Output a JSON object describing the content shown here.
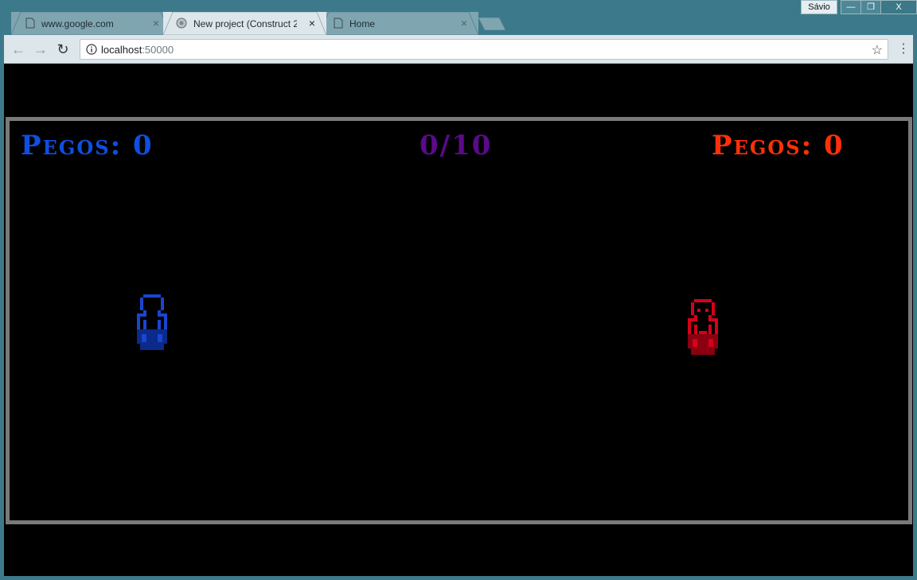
{
  "window": {
    "profile_label": "Sávio",
    "minimize_glyph": "—",
    "maximize_glyph": "❐",
    "close_glyph": "X"
  },
  "tabs": [
    {
      "label": "www.google.com",
      "close": "×",
      "active": false
    },
    {
      "label": "New project (Construct 2",
      "close": "×",
      "active": true
    },
    {
      "label": "Home",
      "close": "×",
      "active": false
    }
  ],
  "toolbar": {
    "back_glyph": "←",
    "forward_glyph": "→",
    "reload_glyph": "↻",
    "url_host": "localhost",
    "url_port": ":50000",
    "star_glyph": "☆",
    "menu_glyph": "⋮"
  },
  "game": {
    "left_score": "Pegos: 0",
    "center_score": "0/10",
    "right_score": "Pegos: 0",
    "colors": {
      "left": "#0f4fe0",
      "center": "#5a0a8a",
      "right": "#ff3008",
      "border": "#7a7a7a",
      "blue_char": "#1a45d0",
      "red_char": "#d8001a"
    }
  }
}
